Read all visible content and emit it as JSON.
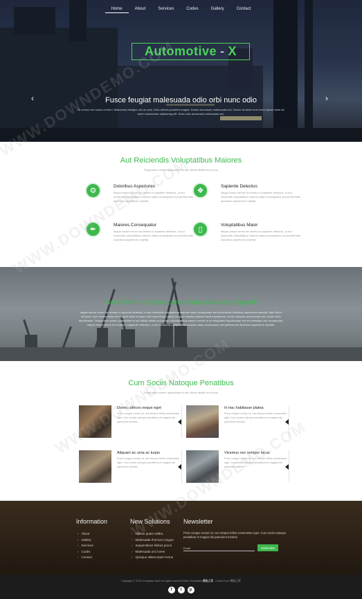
{
  "nav": [
    "Home",
    "About",
    "Services",
    "Codes",
    "Gallery",
    "Contact"
  ],
  "logo": {
    "left": "Automotive",
    "sep": "-",
    "right": "X"
  },
  "hero": {
    "title": "Fusce feugiat malesuada odio orbi nunc odio",
    "text": "At cursus nec luctus a lorem. Maecenas tristique orci ac sem. Duis ultrices pharetra magna. Donec accumsan malesuada orci. Donec sit amet eros lorem ipsum dolor sit amet consectetur adipisicing elit. Nunc odio accumsan malesuada orci."
  },
  "section1": {
    "title": "Aut Reiciendis Voluptatibus Maiores",
    "subtitle": "Temporibus autem quibusdam et aut officiis debitis aut rerum",
    "features": [
      {
        "icon": "gear-icon",
        "title": "Doloribus Asperiores",
        "text": "Itaque earum rerum hic tenetur a sapiente delectus, ut aut reiciendis voluptatibus maiores alias consequatur aut perferendis doloribus asperiores repellat."
      },
      {
        "icon": "share-icon",
        "title": "Sapiente Delectus",
        "text": "Itaque earum rerum hic tenetur a sapiente delectus, ut aut reiciendis voluptatibus maiores alias consequatur aut perferendis doloribus asperiores repellat."
      },
      {
        "icon": "wrench-icon",
        "title": "Maiores Consequatur",
        "text": "Itaque earum rerum hic tenetur a sapiente delectus, ut aut reiciendis voluptatibus maiores alias consequatur aut perferendis doloribus asperiores repellat."
      },
      {
        "icon": "mobile-icon",
        "title": "Voluptatibus Maior",
        "text": "Itaque earum rerum hic tenetur a sapiente delectus, ut aut reiciendis voluptatibus maiores alias consequatur aut perferendis doloribus asperiores repellat."
      }
    ]
  },
  "band": {
    "title": "Nam libero tempore cum soluta nobis est eligendi",
    "text": "Itaque earum rerum hic tenetur a sapiente delectus, ut aut reiciendis voluptatibus maiores alias consequatur aut perferendis doloribus asperiores repellat. Nam libero tempore, cum soluta nobis est eligendi optio cumque nihil impedit quo minus id quod maxime placeat facere possimus, omnis voluptas assumenda est, omnis dolor repellendus. Temporibus autem quibusdam et aut officiis debitis aut rerum necessitatibus saepe eveniet ut et voluptates repudiandae sint et molestiae non recusandae. Itaque earum rerum hic tenetur a sapiente delectus, ut aut reiciendis voluptatibus maiores alias consequatur aut perferendis doloribus asperiores repellat."
  },
  "section2": {
    "title": "Cum Sociis Natoque Penatibus",
    "subtitle": "Temporibus autem quibusdam et aut officiis debitis aut rerum",
    "cards": [
      {
        "title": "Donec ultrices neque eget",
        "text": "Proin congue metus mi, nec tempor tellus consectetur eget. Cum sociis natoque penatibus et magnis dis parturient montes."
      },
      {
        "title": "In hac habitasse platea",
        "text": "Proin congue metus mi, nec tempor tellus consectetur eget. Cum sociis natoque penatibus et magnis dis parturient montes."
      },
      {
        "title": "Aliquam ac urna ac turpis",
        "text": "Proin congue metus mi, nec tempor tellus consectetur eget. Cum sociis natoque penatibus et magnis dis parturient montes."
      },
      {
        "title": "Vivamus nec semper lacus",
        "text": "Proin congue metus mi, nec tempor tellus consectetur eget. Cum sociis natoque penatibus et magnis dis parturient montes."
      }
    ]
  },
  "footer": {
    "info_title": "Information",
    "info_links": [
      "About",
      "Gallery",
      "Services",
      "Codes",
      "Contact"
    ],
    "solutions_title": "New Solutions",
    "solutions_links": [
      "Nullam quam velitra",
      "Malesuada rhoncus congue",
      "Suspendisse finibus purus",
      "Malesuada orci lorem",
      "Quisque ullamcorper lectus"
    ],
    "news_title": "Newsletter",
    "news_text": "Proin congue metus mi, nec tempor tellus consectetur eget. Cum sociis natoque penatibus et magnis dis parturient montes.",
    "news_placeholder": "Email",
    "news_button": "Subscribe",
    "copyright_pre": "Copyright © 2016 Company name All rights reserved.More Templates",
    "copyright_hl": "模板之家",
    "copyright_post": "- Collect from 模板之家",
    "socials": [
      "f",
      "t",
      "p"
    ]
  },
  "watermark": "WWW.DOWNDEMO.COM"
}
